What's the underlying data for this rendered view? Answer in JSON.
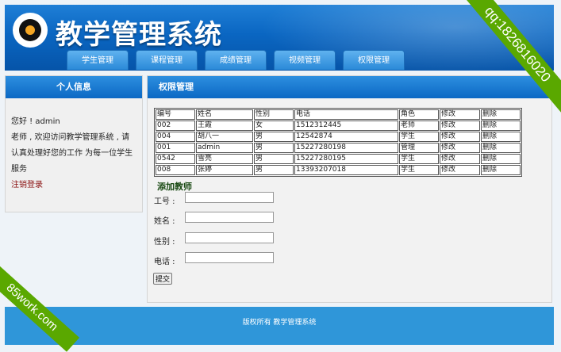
{
  "header": {
    "title": "教学管理系统",
    "nav": [
      "学生管理",
      "课程管理",
      "成绩管理",
      "视频管理",
      "权限管理"
    ]
  },
  "sidebar": {
    "title": "个人信息",
    "greeting": "您好 ! admin",
    "message": "老师 , 欢迎访问教学管理系统 , 请认真处理好您的工作 为每一位学生服务",
    "logout": "注销登录"
  },
  "main": {
    "title": "权限管理",
    "table": {
      "headers": [
        "编号",
        "姓名",
        "性别",
        "电话",
        "角色",
        "修改",
        "删除"
      ],
      "rows": [
        [
          "002",
          "王霞",
          "女",
          "1512312445",
          "老师",
          "修改",
          "删除"
        ],
        [
          "004",
          "胡八一",
          "男",
          "12542874",
          "学生",
          "修改",
          "删除"
        ],
        [
          "001",
          "admin",
          "男",
          "15227280198",
          "管理",
          "修改",
          "删除"
        ],
        [
          "0542",
          "雪亮",
          "男",
          "15227280195",
          "学生",
          "修改",
          "删除"
        ],
        [
          "008",
          "张婷",
          "男",
          "13393207018",
          "学生",
          "修改",
          "删除"
        ]
      ]
    },
    "add_title": "添加教师",
    "form": {
      "fields": [
        {
          "label": "工号 :",
          "value": ""
        },
        {
          "label": "姓名 :",
          "value": ""
        },
        {
          "label": "性别 :",
          "value": ""
        },
        {
          "label": "电话 :",
          "value": ""
        }
      ],
      "submit": "提交"
    }
  },
  "footer": {
    "text": "版权所有 教学管理系统"
  },
  "watermarks": {
    "top_right": "qq:1826816020",
    "bottom_left": "85work.com"
  },
  "colors": {
    "accent": "#0a66c2",
    "footer": "#2f96d9",
    "ribbon": "#5aa800"
  }
}
